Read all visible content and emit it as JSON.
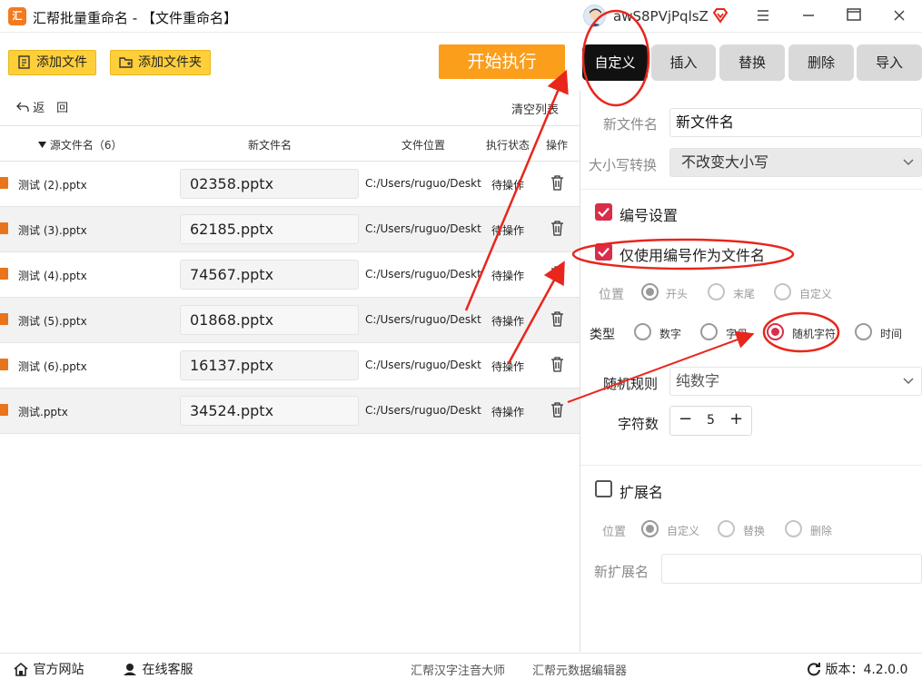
{
  "app": {
    "logo_text": "汇",
    "title": "汇帮批量重命名 - 【文件重命名】",
    "user": "awS8PVjPqlsZ"
  },
  "toolbar": {
    "add_file": "添加文件",
    "add_folder": "添加文件夹",
    "start": "开始执行"
  },
  "tabs": [
    "自定义",
    "插入",
    "替换",
    "删除",
    "导入"
  ],
  "list": {
    "back": "返　回",
    "clear": "清空列表",
    "headers": {
      "source": "源文件名（6）",
      "new_name": "新文件名",
      "location": "文件位置",
      "status": "执行状态",
      "action": "操作"
    },
    "rows": [
      {
        "source": "测试 (2).pptx",
        "new_name": "02358.pptx",
        "path": "C:/Users/ruguo/Desktop",
        "status": "待操作"
      },
      {
        "source": "测试 (3).pptx",
        "new_name": "62185.pptx",
        "path": "C:/Users/ruguo/Desktop",
        "status": "待操作"
      },
      {
        "source": "测试 (4).pptx",
        "new_name": "74567.pptx",
        "path": "C:/Users/ruguo/Desktop",
        "status": "待操作"
      },
      {
        "source": "测试 (5).pptx",
        "new_name": "01868.pptx",
        "path": "C:/Users/ruguo/Desktop",
        "status": "待操作"
      },
      {
        "source": "测试 (6).pptx",
        "new_name": "16137.pptx",
        "path": "C:/Users/ruguo/Desktop",
        "status": "待操作"
      },
      {
        "source": "测试.pptx",
        "new_name": "34524.pptx",
        "path": "C:/Users/ruguo/Desktop",
        "status": "待操作"
      }
    ]
  },
  "panel": {
    "new_name_label": "新文件名",
    "new_name_value": "新文件名",
    "case_label": "大小写转换",
    "case_value": "不改变大小写",
    "numbering_label": "编号设置",
    "numbering_checked": true,
    "only_number_label": "仅使用编号作为文件名",
    "only_number_checked": true,
    "position_label": "位置",
    "position_options": [
      "开头",
      "末尾",
      "自定义"
    ],
    "type_label": "类型",
    "type_options": [
      "数字",
      "字母",
      "随机字符",
      "时间"
    ],
    "type_selected": "随机字符",
    "random_rule_label": "随机规则",
    "random_rule_value": "纯数字",
    "char_count_label": "字符数",
    "char_count_value": "5",
    "minus": "−",
    "plus": "+",
    "ext_label": "扩展名",
    "ext_checked": false,
    "ext_position_label": "位置",
    "ext_position_options": [
      "自定义",
      "替换",
      "删除"
    ],
    "new_ext_label": "新扩展名",
    "new_ext_value": ""
  },
  "footer": {
    "website": "官方网站",
    "support": "在线客服",
    "link1": "汇帮汉字注音大师",
    "link2": "汇帮元数据编辑器",
    "version": "版本：4.2.0.0"
  },
  "colors": {
    "accent": "#fa9e1b",
    "button_yellow": "#ffcf3a",
    "check_red": "#d92d4a",
    "annotation_red": "#e8261c"
  }
}
